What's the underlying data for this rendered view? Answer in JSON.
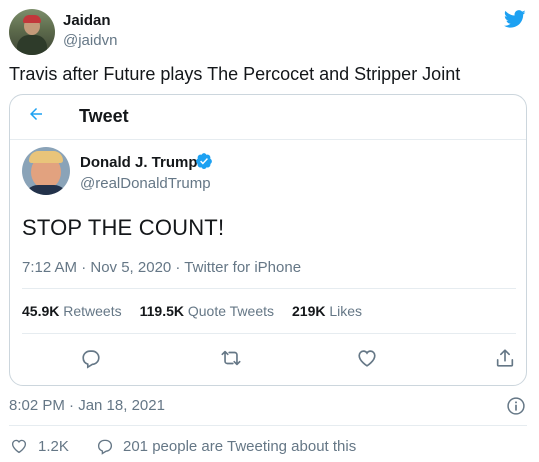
{
  "author": {
    "name": "Jaidan",
    "handle": "@jaidvn"
  },
  "tweet": {
    "text": "Travis after Future plays The Percocet and Stripper Joint",
    "time": "8:02 PM · Jan 18, 2021"
  },
  "quoted": {
    "header_title": "Tweet",
    "name": "Donald J. Trump",
    "handle": "@realDonaldTrump",
    "text": "STOP THE COUNT!",
    "meta": "7:12 AM · Nov 5, 2020 · Twitter for iPhone",
    "stats": {
      "retweets_count": "45.9K",
      "retweets_label": "Retweets",
      "quote_count": "119.5K",
      "quote_label": "Quote Tweets",
      "likes_count": "219K",
      "likes_label": "Likes"
    }
  },
  "footer": {
    "like_count": "1.2K",
    "tweeting": "201 people are Tweeting about this"
  },
  "icons": [
    "twitter-bird-icon",
    "back-arrow-icon",
    "verified-badge-icon",
    "reply-icon",
    "retweet-icon",
    "heart-icon",
    "share-icon",
    "info-icon"
  ],
  "colors": {
    "twitter_blue": "#1da1f2",
    "secondary_text": "#657786",
    "border": "#ccd6dd"
  }
}
